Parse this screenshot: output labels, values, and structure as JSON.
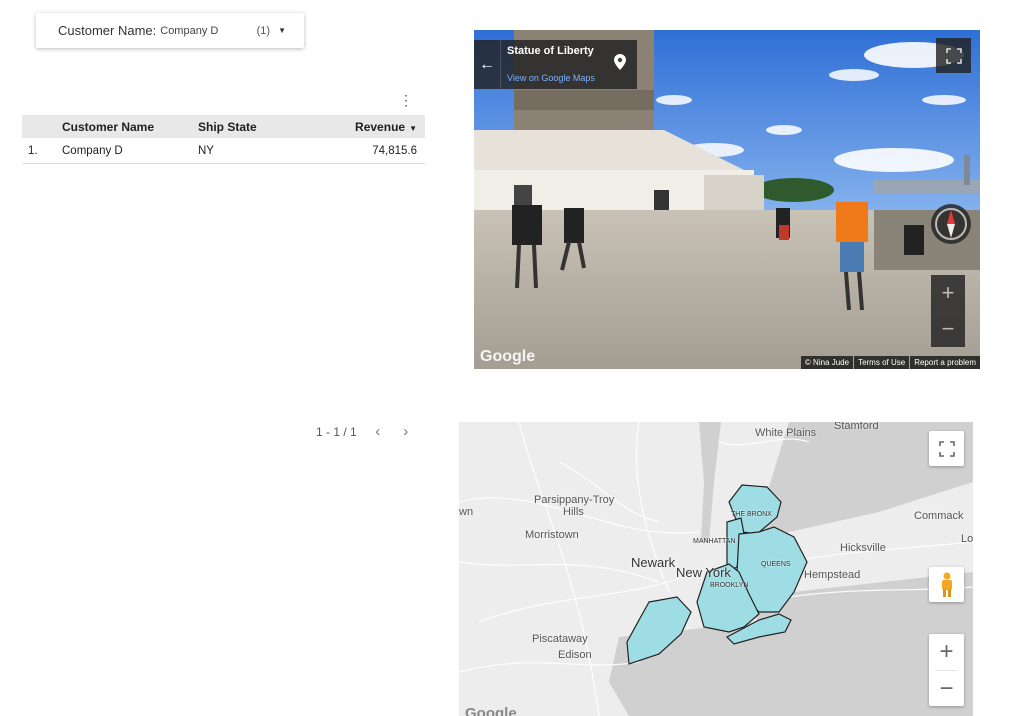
{
  "filter": {
    "label": "Customer Name:",
    "value": "Company D",
    "count": "(1)"
  },
  "table": {
    "columns": [
      "Customer Name",
      "Ship State",
      "Revenue"
    ],
    "rows": [
      {
        "index": "1.",
        "customer": "Company D",
        "state": "NY",
        "revenue": "74,815.6"
      }
    ]
  },
  "pagination": {
    "range": "1 - 1 / 1"
  },
  "streetview": {
    "title": "Statue of Liberty",
    "link": "View on Google Maps",
    "logo": "Google",
    "attribution": [
      "© Nina Jude",
      "Terms of Use",
      "Report a problem"
    ],
    "icons": [
      "back-arrow-icon",
      "location-pin-icon",
      "fullscreen-icon",
      "compass-icon",
      "zoom-in-icon",
      "zoom-out-icon"
    ]
  },
  "map": {
    "labels": {
      "white_plains": "White Plains",
      "stamford": "Stamford",
      "parsippany": "Parsippany-Troy",
      "hills": "Hills",
      "morristown": "Morristown",
      "commack": "Commack",
      "hicksville": "Hicksville",
      "newark": "Newark",
      "new_york": "New York",
      "hempstead": "Hempstead",
      "piscataway": "Piscataway",
      "edison": "Edison",
      "the_bronx": "THE BRONX",
      "manhattan": "MANHATTAN",
      "queens": "QUEENS",
      "brooklyn": "BROOKLYN",
      "edge_w": "wn",
      "edge_lo": "Lo"
    },
    "logo": "Google",
    "highlight_color": "#9fdde4",
    "icons": [
      "fullscreen-icon",
      "pegman-icon",
      "zoom-in-icon",
      "zoom-out-icon"
    ]
  }
}
